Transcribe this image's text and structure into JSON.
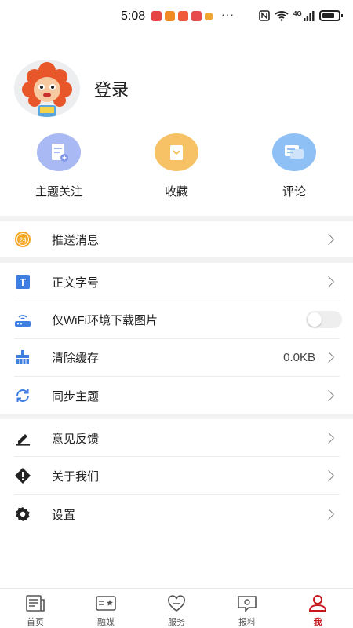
{
  "status_bar": {
    "time": "5:08",
    "more": "···",
    "network": "4G"
  },
  "profile": {
    "login_label": "登录"
  },
  "quick_actions": [
    {
      "label": "主题关注",
      "color": "#a9b9f3"
    },
    {
      "label": "收藏",
      "color": "#f7c266"
    },
    {
      "label": "评论",
      "color": "#8ec0f5"
    }
  ],
  "menu": {
    "push": {
      "label": "推送消息",
      "badge": "24"
    },
    "font_size": {
      "label": "正文字号",
      "badge": "T"
    },
    "wifi_images": {
      "label": "仅WiFi环境下载图片",
      "enabled": false
    },
    "clear_cache": {
      "label": "清除缓存",
      "value": "0.0KB"
    },
    "sync_topics": {
      "label": "同步主题"
    },
    "feedback": {
      "label": "意见反馈"
    },
    "about": {
      "label": "关于我们"
    },
    "settings": {
      "label": "设置"
    }
  },
  "bottom_nav": [
    {
      "label": "首页",
      "active": false
    },
    {
      "label": "融媒",
      "active": false
    },
    {
      "label": "服务",
      "active": false
    },
    {
      "label": "报料",
      "active": false
    },
    {
      "label": "我",
      "active": true
    }
  ],
  "colors": {
    "accent": "#c8161d",
    "section_gap": "#f2f2f2",
    "icon_blue": "#3d7ee0",
    "push_icon": "#f5a623"
  }
}
